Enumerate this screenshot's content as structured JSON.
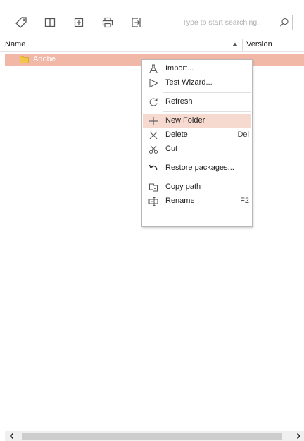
{
  "toolbar": {
    "buttons": [
      "tag-icon",
      "columns-icon",
      "add-box-icon",
      "print-icon",
      "export-icon"
    ],
    "search_placeholder": "Type to start searching..."
  },
  "columns": {
    "name": "Name",
    "version": "Version",
    "sort": "ascending"
  },
  "rows": [
    {
      "label": "Adobe",
      "icon": "folder-icon",
      "selected": true
    }
  ],
  "context_menu": {
    "import": "Import...",
    "test_wizard": "Test Wizard...",
    "refresh": "Refresh",
    "new_folder": "New Folder",
    "delete": "Delete",
    "delete_key": "Del",
    "cut": "Cut",
    "restore": "Restore packages...",
    "copy_path": "Copy path",
    "rename": "Rename",
    "rename_key": "F2",
    "highlighted": "new_folder"
  },
  "colors": {
    "selection": "#f2b8a7",
    "menu_highlight": "#f6d9cf",
    "folder": "#f3c64a",
    "icon": "#555555"
  }
}
